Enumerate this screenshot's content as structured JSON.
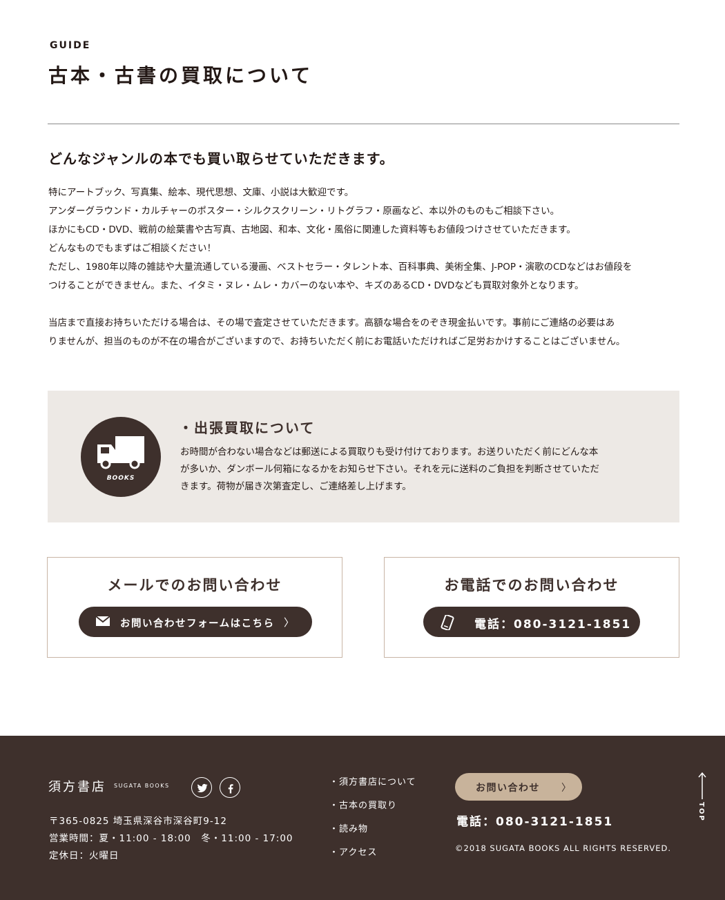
{
  "header": {
    "guide_label": "GUIDE",
    "title": "古本・古書の買取について"
  },
  "main": {
    "lead": "どんなジャンルの本でも買い取らせていただきます。",
    "paragraph1": [
      "特にアートブック、写真集、絵本、現代思想、文庫、小説は大歓迎です。",
      "アンダーグラウンド・カルチャーのポスター・シルクスクリーン・リトグラフ・原画など、本以外のものもご相談下さい。",
      "ほかにもCD・DVD、戦前の絵葉書や古写真、古地図、和本、文化・風俗に関連した資料等もお値段つけさせていただきます。",
      "どんなものでもまずはご相談ください！",
      "ただし、1980年以降の雑誌や大量流通している漫画、ベストセラー・タレント本、百科事典、美術全集、J-POP・演歌のCDなどはお値段を",
      "つけることができません。また、イタミ・ヌレ・ムレ・カバーのない本や、キズのあるCD・DVDなども買取対象外となります。"
    ],
    "paragraph2": [
      "当店まで直接お持ちいただける場合は、その場で査定させていただきます。高額な場合をのぞき現金払いです。事前にご連絡の必要はあ",
      "りませんが、担当のものが不在の場合がございますので、お持ちいただく前にお電話いただければご足労おかけすることはございません。"
    ]
  },
  "service": {
    "badge_label": "BOOKS",
    "badge_icon": "truck-icon",
    "title": "・出張買取について",
    "text": [
      "お時間が合わない場合などは郵送による買取りも受け付けております。お送りいただく前にどんな本",
      "が多いか、ダンボール何箱になるかをお知らせ下さい。それを元に送料のご負担を判断させていただ",
      "きます。荷物が届き次第査定し、ご連絡差し上げます。"
    ]
  },
  "contact": {
    "mail": {
      "title": "メールでのお問い合わせ",
      "button_label": "お問い合わせフォームはこちら",
      "arrow": "〉",
      "icon": "envelope-icon"
    },
    "tel": {
      "title": "お電話でのお問い合わせ",
      "button_label": "電話：080-3121-1851",
      "icon": "phone-icon"
    }
  },
  "footer": {
    "logo": "須方書店",
    "logo_en": "SUGATA BOOKS",
    "social": [
      "twitter-icon",
      "facebook-icon"
    ],
    "address": [
      "〒365-0825 埼玉県深谷市深谷町9-12",
      "営業時間：夏・11:00 - 18:00　冬・11:00 - 17:00",
      "定休日：火曜日"
    ],
    "nav": [
      "・須方書店について",
      "・古本の買取り",
      "・読み物",
      "・アクセス"
    ],
    "contact_button": "お問い合わせ",
    "contact_arrow": "〉",
    "tel": "電話：080-3121-1851",
    "copyright": "©2018 SUGATA BOOKS ALL RIGHTS RESERVED.",
    "to_top": "TOP"
  },
  "colors": {
    "brand_dark": "#3e302c",
    "accent_beige": "#c8b39b",
    "box_bg": "#ede9e5",
    "card_border": "#c8b5a5"
  }
}
